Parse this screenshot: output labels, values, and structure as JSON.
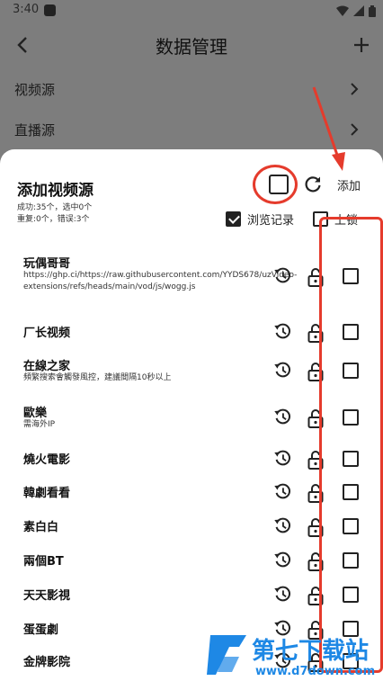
{
  "status": {
    "time": "3:40"
  },
  "header": {
    "title": "数据管理"
  },
  "settings": [
    {
      "label": "视频源"
    },
    {
      "label": "直播源"
    }
  ],
  "sheet": {
    "title": "添加视频源",
    "stat_line1": "成功:35个，选中0个",
    "stat_line2": "重复:0个，错误:3个",
    "add_label": "添加",
    "options": {
      "history": {
        "label": "浏览记录",
        "checked": true
      },
      "lock": {
        "label": "上锁",
        "checked": false
      }
    }
  },
  "sources": [
    {
      "name": "玩偶哥哥",
      "sub": "https://ghp.ci/https://raw.githubusercontent.com/YYDS678/uzVideo-extensions/refs/heads/main/vod/js/wogg.js"
    },
    {
      "name": "厂长视频",
      "sub": ""
    },
    {
      "name": "在線之家",
      "sub": "頻繁搜索會觸發風控，建議間隔10秒以上"
    },
    {
      "name": "歐樂",
      "sub": "需海外IP"
    },
    {
      "name": "燒火電影",
      "sub": ""
    },
    {
      "name": "韓劇看看",
      "sub": ""
    },
    {
      "name": "素白白",
      "sub": ""
    },
    {
      "name": "兩個BT",
      "sub": ""
    },
    {
      "name": "天天影視",
      "sub": ""
    },
    {
      "name": "蛋蛋劇",
      "sub": ""
    },
    {
      "name": "金牌影院",
      "sub": ""
    }
  ],
  "watermark": {
    "brand": "第七下载站",
    "url": "www.d7down.com"
  },
  "colors": {
    "annotation": "#e53b2c",
    "overlay": "#7d7d7d",
    "watermark_blue": "#1e88e5"
  },
  "icons": [
    "back-arrow-icon",
    "plus-icon",
    "chevron-right-icon",
    "refresh-icon",
    "history-icon",
    "unlock-icon",
    "checkbox-icon"
  ]
}
